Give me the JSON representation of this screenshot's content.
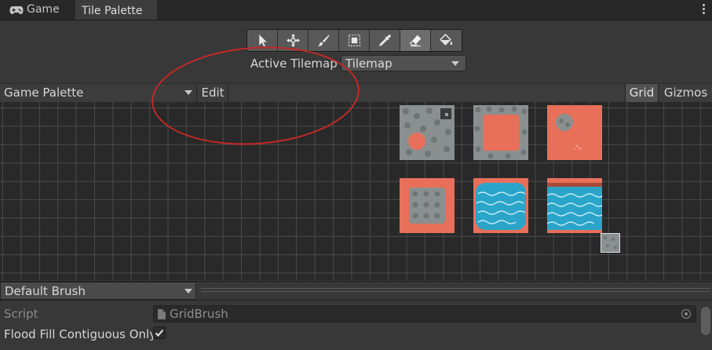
{
  "tabs": [
    {
      "label": "Game",
      "icon": "gamepad-icon"
    },
    {
      "label": "Tile Palette"
    }
  ],
  "toolbar": {
    "tools": [
      "select-icon",
      "move-icon",
      "paint-brush-icon",
      "box-fill-icon",
      "picker-icon",
      "eraser-icon",
      "bucket-fill-icon"
    ],
    "active_tool": "eraser-icon"
  },
  "active_tilemap": {
    "label": "Active Tilemap",
    "value": "Tilemap"
  },
  "palette_bar": {
    "palette": "Game Palette",
    "edit": "Edit",
    "grid": "Grid",
    "gizmos": "Gizmos"
  },
  "brush": {
    "value": "Default Brush"
  },
  "inspector": {
    "script_label": "Script",
    "script_value": "GridBrush",
    "flood_fill_label": "Flood Fill Contiguous Only",
    "flood_fill_checked": true
  },
  "colors": {
    "annotation": "#c62828",
    "tile_orange": "#e8705a",
    "water": "#2aa5c9",
    "stone": "#8a8f8f"
  }
}
